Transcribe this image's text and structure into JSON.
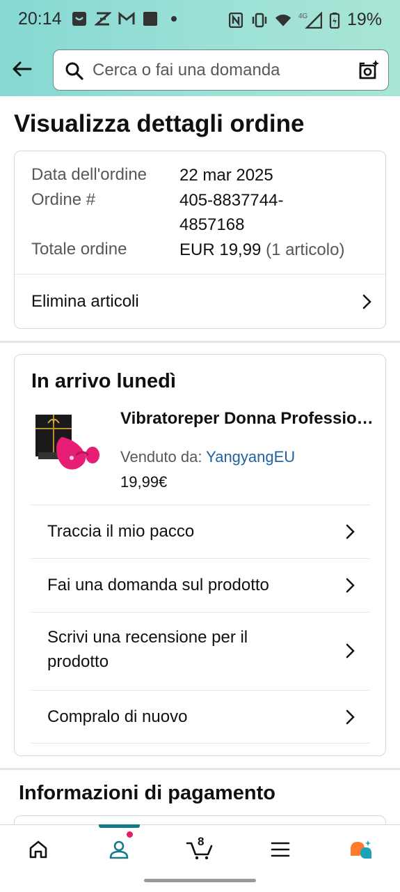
{
  "status_bar": {
    "time": "20:14",
    "battery": "19%",
    "network": "4G",
    "icons_left": [
      "smile-box-icon",
      "x-app-icon",
      "gmail-icon",
      "square-icon",
      "dot-icon"
    ],
    "icons_right": [
      "nfc-icon",
      "vibrate-icon",
      "wifi-icon",
      "signal-icon",
      "battery-icon"
    ]
  },
  "search": {
    "placeholder": "Cerca o fai una domanda"
  },
  "page": {
    "title": "Visualizza dettagli ordine"
  },
  "order": {
    "date_label": "Data dell'ordine",
    "date_value": "22 mar 2025",
    "number_label": "Ordine #",
    "number_value_line1": "405-8837744-",
    "number_value_line2": "4857168",
    "total_label": "Totale ordine",
    "total_value": "EUR 19,99",
    "total_count": "(1 articolo)",
    "delete_items": "Elimina articoli"
  },
  "arrival": {
    "title": "In arrivo lunedì",
    "product_name": "Vibratoreper Donna Professionale",
    "seller_label": "Venduto da:",
    "seller_name": "YangyangEU",
    "price": "19,99€",
    "actions": [
      {
        "label": "Traccia il mio pacco"
      },
      {
        "label": "Fai una domanda sul prodotto"
      },
      {
        "label_line1": "Scrivi una recensione per il",
        "label_line2": "prodotto"
      },
      {
        "label": "Compralo di nuovo"
      }
    ]
  },
  "payment": {
    "title": "Informazioni di pagamento"
  },
  "bottom_nav": {
    "items": [
      "home-icon",
      "account-icon",
      "cart-icon",
      "menu-icon",
      "rufus-icon"
    ],
    "cart_count": "8",
    "active": "account",
    "accent": "#137a87"
  },
  "colors": {
    "header_gradient_start": "#85d8d3",
    "header_gradient_end": "#a8e5d4",
    "link": "#2162a1",
    "text": "#0f1111",
    "muted": "#565959",
    "notification_dot": "#e31c5f"
  }
}
